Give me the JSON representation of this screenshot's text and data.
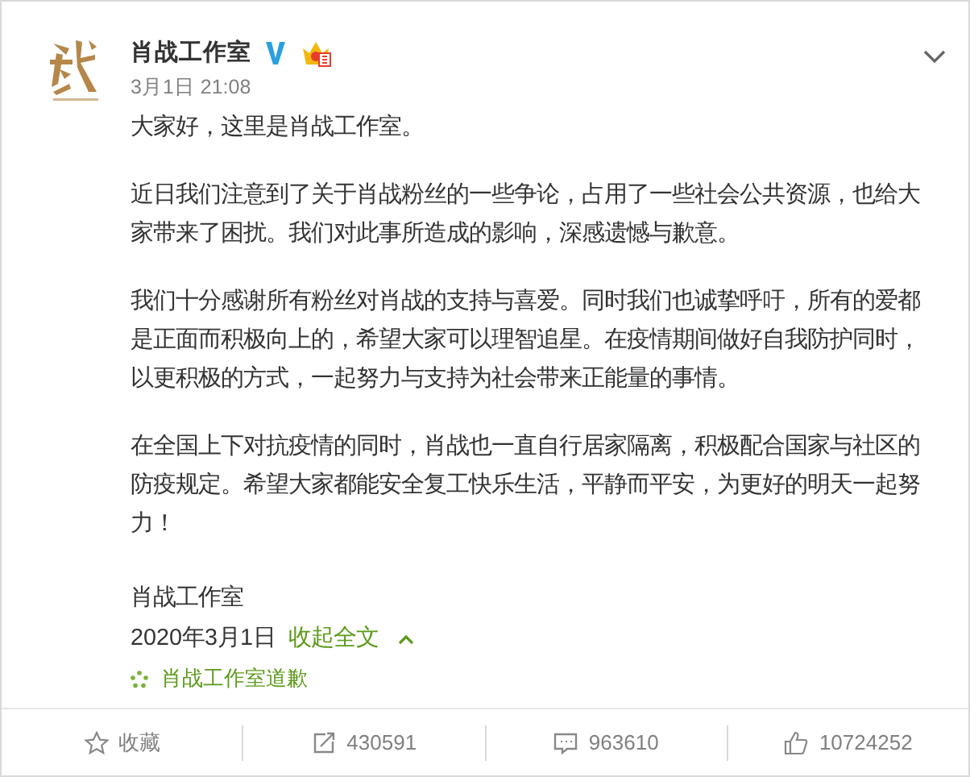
{
  "post": {
    "author": "肖战工作室",
    "time": "3月1日 21:08",
    "paragraphs": [
      "大家好，这里是肖战工作室。",
      "近日我们注意到了关于肖战粉丝的一些争论，占用了一些社会公共资源，也给大家带来了困扰。我们对此事所造成的影响，深感遗憾与歉意。",
      "我们十分感谢所有粉丝对肖战的支持与喜爱。同时我们也诚挚呼吁，所有的爱都是正面而积极向上的，希望大家可以理智追星。在疫情期间做好自我防护同时，以更积极的方式，一起努力与支持为社会带来正能量的事情。",
      "在全国上下对抗疫情的同时，肖战也一直自行居家隔离，积极配合国家与社区的防疫规定。希望大家都能安全复工快乐生活，平静而平安，为更好的明天一起努力！"
    ],
    "signature": "肖战工作室",
    "date": "2020年3月1日",
    "collapse_link": "收起全文",
    "topic": "肖战工作室道歉"
  },
  "actions": [
    {
      "kind": "favorite",
      "label": "收藏"
    },
    {
      "kind": "repost",
      "label": "430591"
    },
    {
      "kind": "comment",
      "label": "963610"
    },
    {
      "kind": "like",
      "label": "10724252"
    }
  ]
}
